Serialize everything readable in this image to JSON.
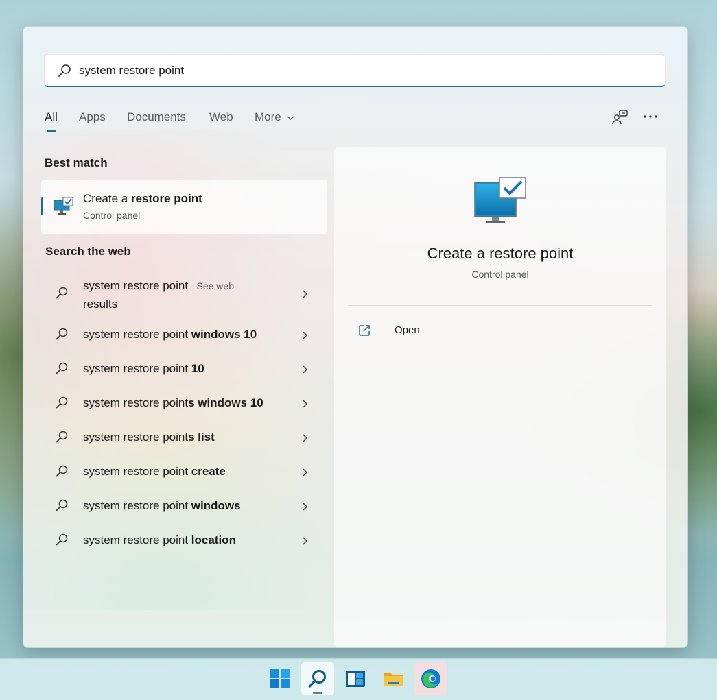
{
  "search": {
    "value": "system restore point",
    "placeholder": ""
  },
  "tabs": [
    {
      "label": "All",
      "active": true
    },
    {
      "label": "Apps"
    },
    {
      "label": "Documents"
    },
    {
      "label": "Web"
    },
    {
      "label": "More"
    }
  ],
  "header_icons": [
    "feedback-icon",
    "more-options-icon"
  ],
  "best_match": {
    "heading": "Best match",
    "title_prefix": "Create a ",
    "title_bold": "restore point",
    "subtitle": "Control panel",
    "icon": "monitor-checkmark-icon"
  },
  "search_web": {
    "heading": "Search the web",
    "items": [
      {
        "query": "system restore point",
        "suffix_bold": "",
        "extra": " - See web",
        "extra2": "results"
      },
      {
        "query": "system restore point ",
        "suffix_bold": "windows 10"
      },
      {
        "query": "system restore point ",
        "suffix_bold": "10"
      },
      {
        "query": "system restore point",
        "suffix_bold": "s windows 10"
      },
      {
        "query": "system restore point",
        "suffix_bold": "s list"
      },
      {
        "query": "system restore point ",
        "suffix_bold": "create"
      },
      {
        "query": "system restore point ",
        "suffix_bold": "windows"
      },
      {
        "query": "system restore point ",
        "suffix_bold": "location"
      }
    ]
  },
  "preview": {
    "title": "Create a restore point",
    "subtitle": "Control panel",
    "actions": [
      {
        "label": "Open",
        "icon": "open-external-icon"
      }
    ]
  },
  "taskbar": {
    "items": [
      {
        "name": "start-icon",
        "active": false
      },
      {
        "name": "search-icon",
        "active": true
      },
      {
        "name": "widgets-icon",
        "active": false
      },
      {
        "name": "file-explorer-icon",
        "active": false
      },
      {
        "name": "edge-icon",
        "active": false,
        "hover": true
      }
    ]
  },
  "colors": {
    "accent": "#1d6f82",
    "text_primary": "#1b1b1b",
    "text_secondary": "#5b5b5b",
    "edge_blue": "#0f7bd6",
    "edge_green": "#3cc25a",
    "folder_yellow": "#f5c542"
  }
}
